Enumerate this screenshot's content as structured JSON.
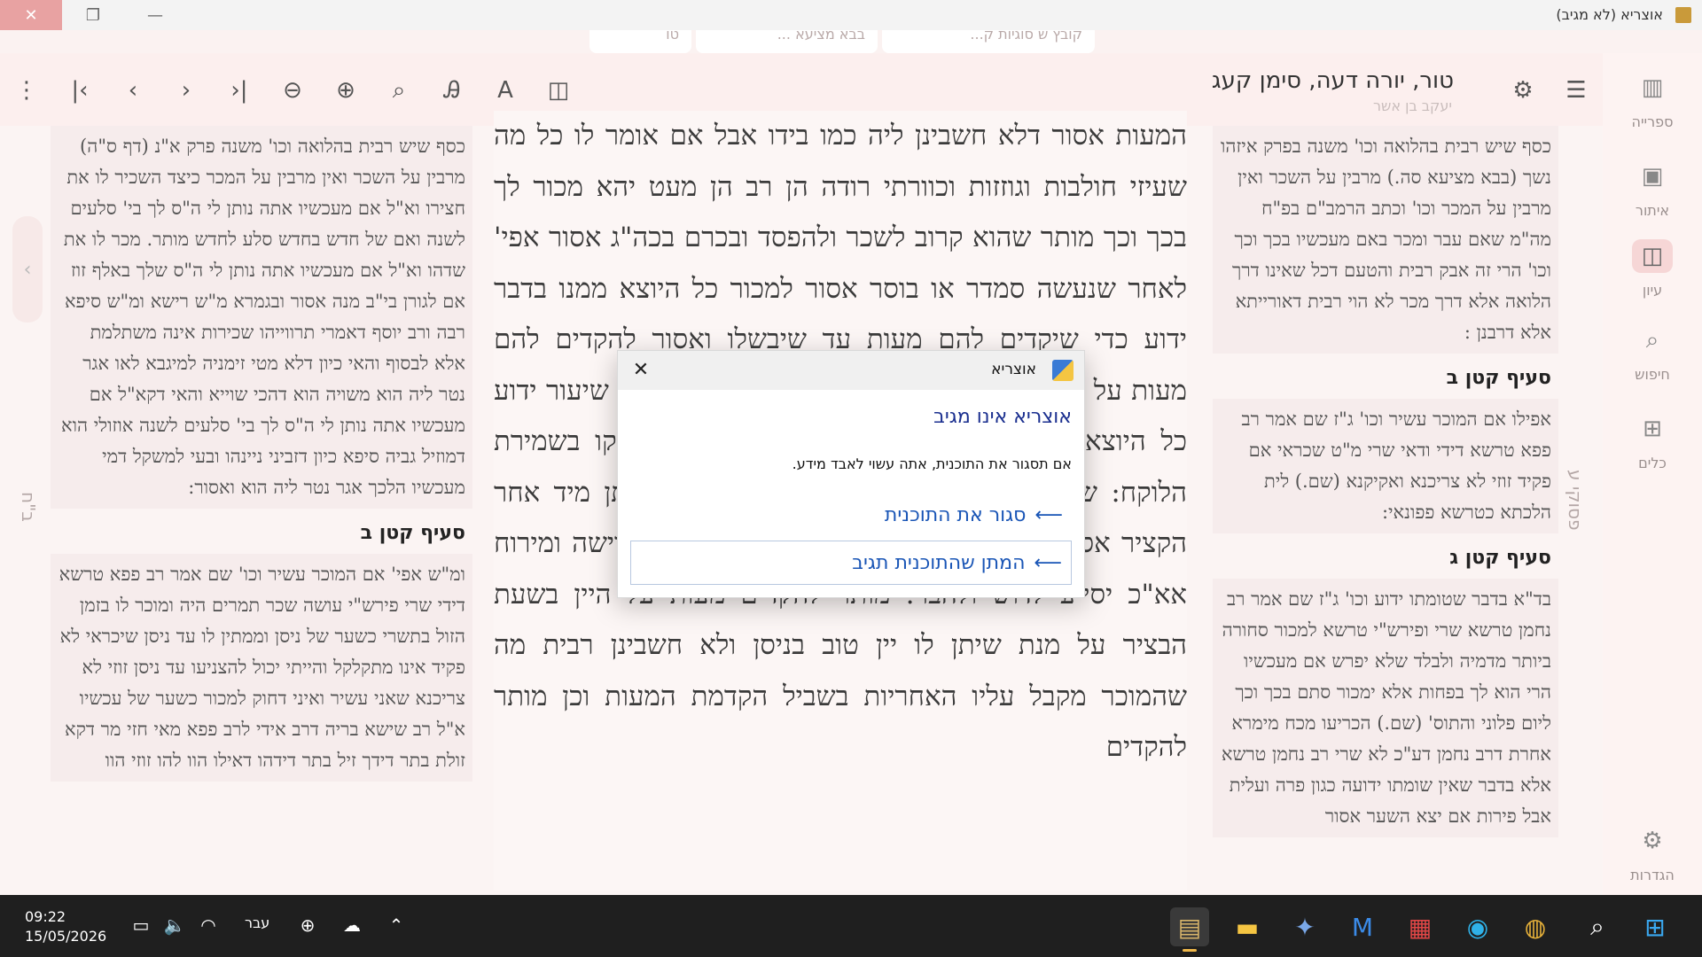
{
  "window": {
    "title": "אוצריא (לא מגיב)"
  },
  "tabs": [
    "קובץ ש סוגיות ק...",
    "בבא מציעא ...",
    "טו"
  ],
  "toolbar": {
    "doc_title": "טור, יורה דעה, סימן קעג",
    "doc_author": "יעקב בן אשר"
  },
  "rail": [
    {
      "label": "ספרייה",
      "icon": "library-icon"
    },
    {
      "label": "איתור",
      "icon": "find-book-icon"
    },
    {
      "label": "עיון",
      "icon": "reading-icon"
    },
    {
      "label": "חיפוש",
      "icon": "search-icon"
    },
    {
      "label": "כלים",
      "icon": "tools-icon"
    },
    {
      "label": "הגדרות",
      "icon": "settings-icon"
    }
  ],
  "side_labels": {
    "left": "ב\"ח",
    "right": "פסוקי ע"
  },
  "right_commentary": {
    "p1": "כסף שיש רבית בהלואה וכו' משנה בפרק איזהו נשך (בבא מציעא סה.) מרבין על השכר ואין מרבין על המכר וכו' וכתב הרמב\"ם בפ\"ח מה\"מ שאם עבר ומכר באם מעכשיו בכך וכך וכו' הרי זה אבק רבית והטעם דכל שאינו דרך הלואה אלא דרך מכר לא הוי רבית דאורייתא אלא דרבנן :",
    "h2": "סעיף קטן ב",
    "p2": "אפילו אם המוכר עשיר וכו' ג\"ז שם אמר רב פפא טרשא דידי ודאי שרי מ\"ט שכראי אם פקיד זוזי לא צריכנא ואקיקנא (שם.) לית הלכתא כטרשא פפונאי:",
    "h3": "סעיף קטן ג",
    "p3": "בד\"א בדבר שטומתו ידוע וכו' ג\"ז שם אמר רב נחמן טרשא שרי ופירש\"י טרשא למכור סחורה ביותר מדמיה ולבלד שלא יפרש אם מעכשיו הרי הוא לך בפחות אלא ימכור סתם בכך וכך ליום פלוני והתוס' (שם.) הכריעו מכח מימרא אחרת דרב נחמן דע\"כ לא שרי רב נחמן טרשא אלא בדבר שאין שומתו ידועה כגון פרה ועלית אבל פירות אם יצא השער אסור"
  },
  "left_commentary": {
    "p1": "כסף שיש רבית בהלואה וכו' משנה פרק א\"נ (דף ס\"ה) מרבין על השכר ואין מרבין על המכר כיצד השכיר לו את חצירו וא\"ל אם מעכשיו אתה נותן לי ה\"ס לך בי' סלעים לשנה ואם של חדש בחדש סלע לחדש מותר. מכר לו את שדהו וא\"ל אם מעכשיו אתה נותן לי ה\"ס שלך באלף זוז אם לגורן בי\"ב מנה אסור ובגמרא מ\"ש רישא ומ\"ש סיפא רבה ורב יוסף דאמרי תרווייהו שכירות אינה משתלמת אלא לבסוף והאי כיון דלא מטי זימניה למיגבא לאו אגר נטר ליה הוא משויה הוא דהכי שוייא והאי דקא\"ל אם מעכשיו אתה נותן לי ה\"ס לך בי' סלעים לשנה אוזולי הוא דמוזיל גביה סיפא כיון דזביני ניינהו ובעי למשקל דמי מעכשיו הלכך אגר נטר ליה הוא ואסור:",
    "h2": "סעיף קטן ב",
    "p2": "ומ\"ש אפי' אם המוכר עשיר וכו' שם אמר רב פפא טרשא דידי שרי פירש\"י עושה שכר תמרים היה ומוכר לו בזמן הזול בתשרי כשער של ניסן וממתין לו עד ניסן שיכראי לא פקיד אינו מתקלקל והייתי יכול להצניעו עד ניסן זוזי לא צריכנא שאני עשיר ואיני דחוק למכור כשער של עכשיו א\"ל רב שישא בריה דרב אידי לרב פפא מאי חזי מר דקא זולת בתר דידך זיל בתר דידהו דאילו הוו להו זוזי הוו"
  },
  "main_text": "המעות אסור דלא חשבינן ליה כמו בידו אבל אם אומר לו כל מה שעיזי חולבות וגוזזות וכוורתי רודה הן רב הן מעט יהא מכור לך בכך וכך מותר שהוא קרוב לשכר ולהפסד ובכרם בכה\"ג אסור אפי' לאחר שנעשה סמדר או בוסר אסור למכור כל היוצא ממנו בדבר ידוע כדי שיקדים להם מעות עד שיבשלו ואסור להקדים להם מעות על מנת שיחזיקו בשמירתם אבל מותר לקנות עד שיעור ידוע כל היוצא מתחת יד המוכר עד שיגדל ויתבשל ויחזיקו בשמירת הלוקח: שומרי הפירות אסור לו להקדים להן שכירותן מיד אחר הקציר אסור להוסיף להן בשכרן כדי שימתינו אחר חרישה ומירוח אא\"כ יסייע לדוש ולהבר: מותר להקדים מעות על היין בשעת הבציר על מנת שיתן לו יין טוב בניסן ולא חשבינן רבית מה שהמוכר מקבל עליו האחריות בשביל הקדמת המעות וכן מותר להקדים",
  "dialog": {
    "caption": "אוצריא",
    "title": "אוצריא אינו מגיב",
    "message": "אם תסגור את התוכנית, אתה עשוי לאבד מידע.",
    "close_label": "סגור את התוכנית",
    "wait_label": "המתן שהתוכנית תגיב"
  },
  "taskbar": {
    "time": "09:22",
    "date": "15/05/2026",
    "lang": "עבר"
  }
}
